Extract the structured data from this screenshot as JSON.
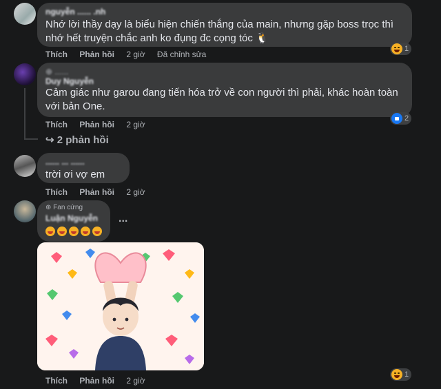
{
  "comments": [
    {
      "author": "nguyễn ...... .nh",
      "text": "Nhớ lời thầy dạy là biểu hiện chiến thắng của main, nhưng gặp boss trọc thì nhớ hết truyện chắc anh ko đụng đc cọng tóc 🐧",
      "actions": {
        "like": "Thích",
        "reply": "Phản hồi",
        "time": "2 giờ",
        "edited": "Đã chỉnh sửa"
      },
      "reaction": {
        "icon": "haha-icon",
        "count": "1"
      }
    },
    {
      "author": "Duy Nguyễn",
      "badge": "⊕ ......",
      "text": "Cảm giác như garou đang tiến hóa trở về con người thì phải, khác hoàn toàn với bản One.",
      "actions": {
        "like": "Thích",
        "reply": "Phản hồi",
        "time": "2 giờ"
      },
      "reaction": {
        "icon": "like-icon",
        "count": "2"
      },
      "replies_link": "↪ 2 phản hồi"
    },
    {
      "author": "...... ... ......",
      "text": "trời ơi vợ em",
      "actions": {
        "like": "Thích",
        "reply": "Phản hồi",
        "time": "2 giờ"
      }
    },
    {
      "badge": "Fan cứng",
      "author": "Luận Nguyễn",
      "more": "...",
      "emojis": [
        "😘",
        "😘",
        "😘",
        "😘",
        "😘"
      ],
      "actions": {
        "like": "Thích",
        "reply": "Phản hồi",
        "time": "2 giờ"
      },
      "reaction": {
        "icon": "haha-icon",
        "count": "1"
      }
    }
  ],
  "colors": {
    "background": "#18191a",
    "bubble": "#3a3b3c",
    "text": "#e4e6eb",
    "muted": "#b0b3b8",
    "like": "#1877f2",
    "haha": "#f7b125"
  }
}
